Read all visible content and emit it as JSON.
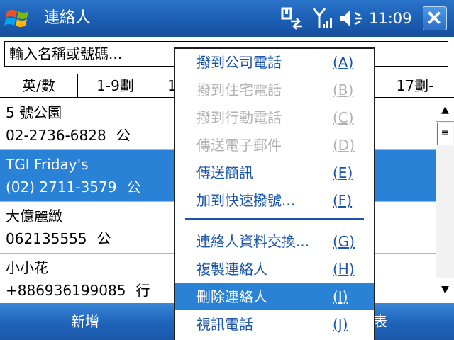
{
  "titlebar": {
    "title": "連絡人",
    "clock": "11:09",
    "icons": [
      "windows-logo-icon",
      "sync-icon",
      "signal-icon",
      "volume-icon",
      "close-icon"
    ]
  },
  "search": {
    "placeholder": "輸入名稱或號碼..."
  },
  "tabs": [
    "英/數",
    "1-9劃",
    "1",
    "17劃-"
  ],
  "contacts": [
    {
      "name": "5 號公園",
      "phone": "02-2736-6828",
      "phone_type": "公",
      "selected": false
    },
    {
      "name": "TGI Friday's",
      "phone": "(02) 2711-3579",
      "phone_type": "公",
      "selected": true
    },
    {
      "name": "大億麗緻",
      "phone": "062135555",
      "phone_type": "公",
      "selected": false
    },
    {
      "name": "小小花",
      "phone": "+886936199085",
      "phone_type": "行",
      "selected": false
    }
  ],
  "softkeys": {
    "left": "新增",
    "right": "表"
  },
  "menu": {
    "items": [
      {
        "label": "撥到公司電話",
        "key": "(A)",
        "state": "enabled"
      },
      {
        "label": "撥到住宅電話",
        "key": "(B)",
        "state": "disabled"
      },
      {
        "label": "撥到行動電話",
        "key": "(C)",
        "state": "disabled"
      },
      {
        "label": "傳送電子郵件",
        "key": "(D)",
        "state": "disabled"
      },
      {
        "label": "傳送簡訊",
        "key": "(E)",
        "state": "enabled"
      },
      {
        "label": "加到快速撥號...",
        "key": "(F)",
        "state": "enabled"
      },
      {
        "label": "連絡人資料交換...",
        "key": "(G)",
        "state": "enabled"
      },
      {
        "label": "複製連絡人",
        "key": "(H)",
        "state": "enabled"
      },
      {
        "label": "刪除連絡人",
        "key": "(I)",
        "state": "highlighted"
      },
      {
        "label": "視訊電話",
        "key": "(J)",
        "state": "enabled"
      }
    ]
  },
  "colors": {
    "titlebar": "#1b5eb3",
    "selection": "#2a82d6",
    "menu_text": "#1c55a8",
    "disabled_text": "#b2b2b2"
  }
}
